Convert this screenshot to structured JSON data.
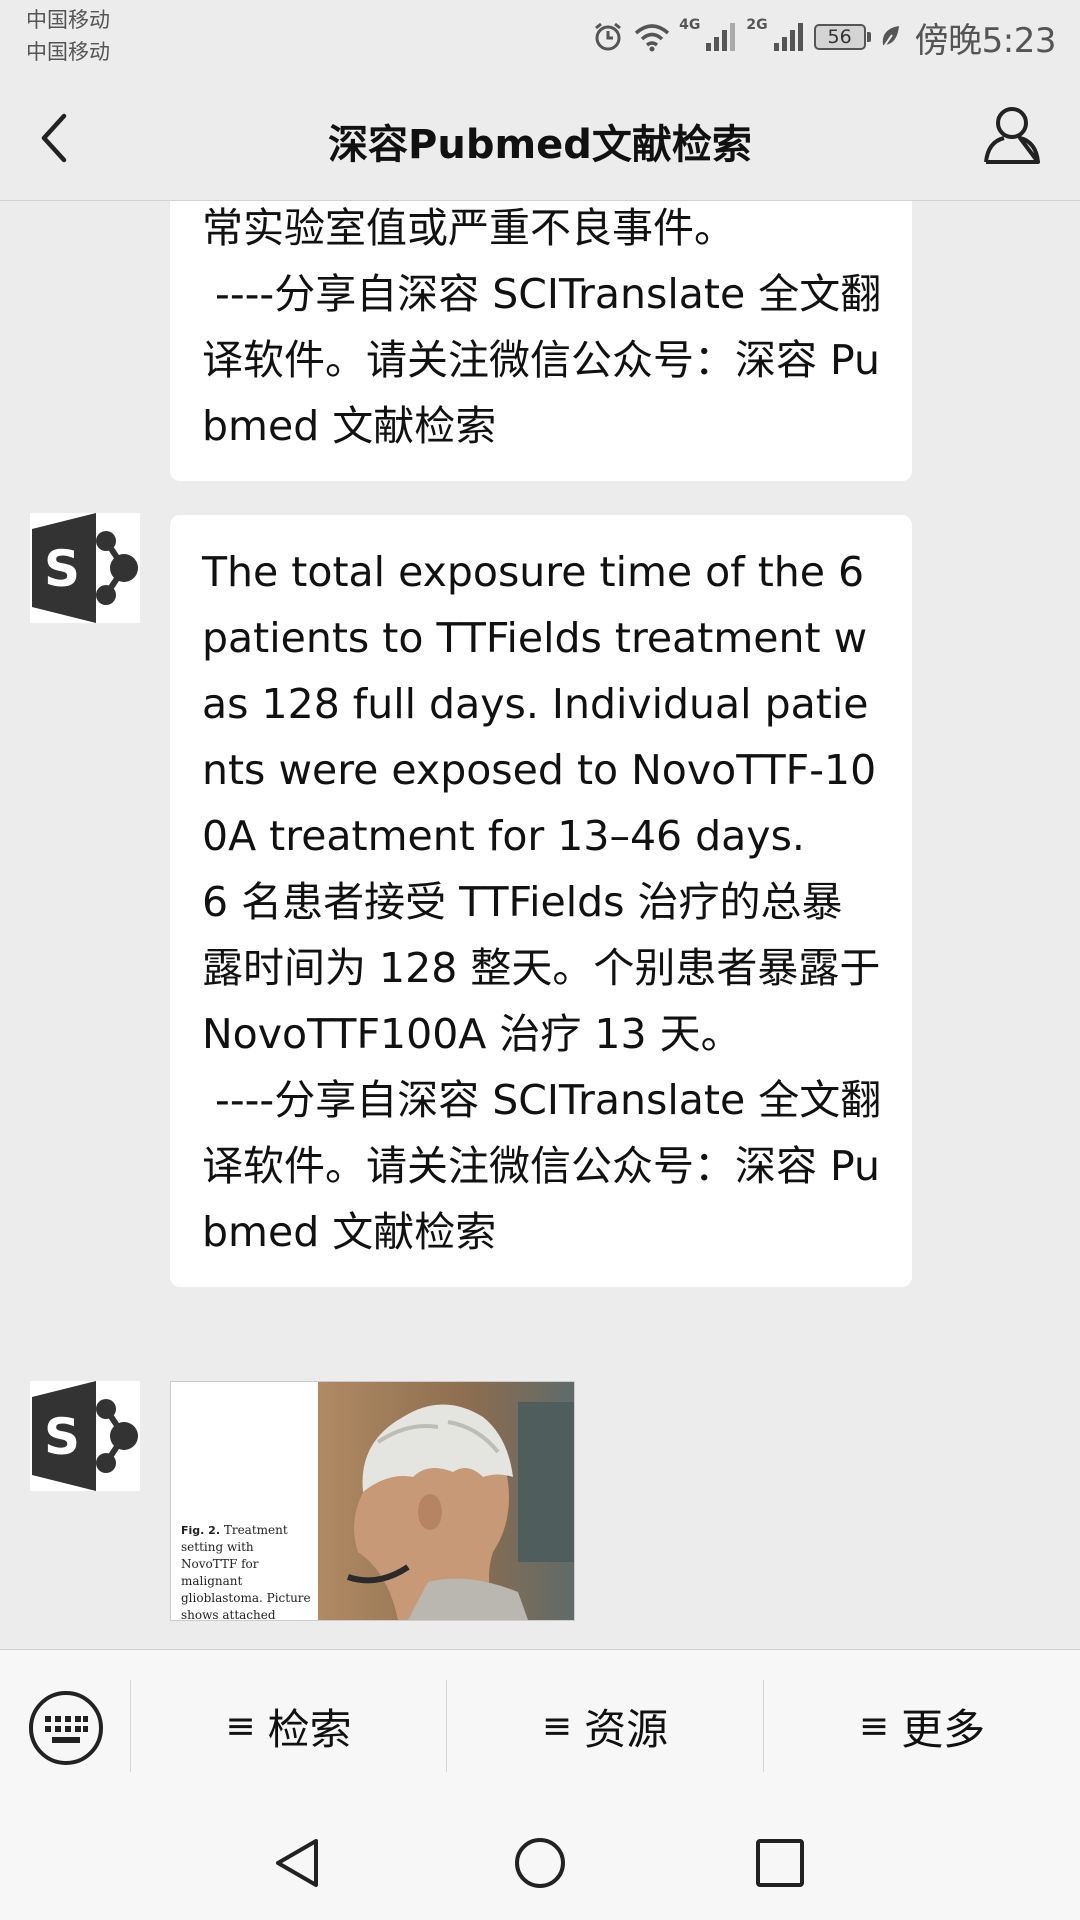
{
  "status_bar": {
    "carrier_1": "中国移动",
    "carrier_2": "中国移动",
    "net_1": "4G",
    "net_2": "2G",
    "battery": "56",
    "time_prefix": "傍晚",
    "time": "5:23",
    "icons": [
      "alarm-icon",
      "wifi-icon",
      "signal-icon",
      "signal-icon",
      "battery-icon",
      "leaf-icon"
    ]
  },
  "nav": {
    "title": "深容Pubmed文献检索",
    "back_icon": "chevron-left-icon",
    "profile_icon": "person-icon"
  },
  "messages": [
    {
      "type": "text",
      "lines": [
        "常实验室值或严重不良事件。",
        " ----分享自深容 SCITranslate 全文翻译软件。请关注微信公众号：深容 Pubmed 文献检索"
      ]
    },
    {
      "type": "text",
      "avatar": "sharepoint-logo",
      "english": "The total exposure time of the 6 patients to TTFields treatment was 128 full days. Individual patients were exposed to NovoTTF-100A treatment for 13–46 days.",
      "chinese": "6 名患者接受 TTFields 治疗的总暴露时间为 128 整天。个别患者暴露于 NovoTTF100A 治疗 13 天。",
      "footer": " ----分享自深容 SCITranslate 全文翻译软件。请关注微信公众号：深容 Pubmed 文献检索"
    },
    {
      "type": "image",
      "avatar": "sharepoint-logo",
      "fig_label": "Fig. 2.",
      "fig_caption": "Treatment setting with NovoTTF for malignant glioblastoma. Picture shows attached electrodes."
    }
  ],
  "menu": {
    "keyboard_icon": "keyboard-icon",
    "items": [
      {
        "label": "检索",
        "icon": "≡"
      },
      {
        "label": "资源",
        "icon": "≡"
      },
      {
        "label": "更多",
        "icon": "≡"
      }
    ]
  },
  "system_nav": [
    "back-triangle-icon",
    "home-circle-icon",
    "recents-square-icon"
  ],
  "colors": {
    "background": "#ececec",
    "bubble": "#ffffff",
    "menu_background": "#f7f7f7",
    "avatar_dark": "#333333"
  }
}
